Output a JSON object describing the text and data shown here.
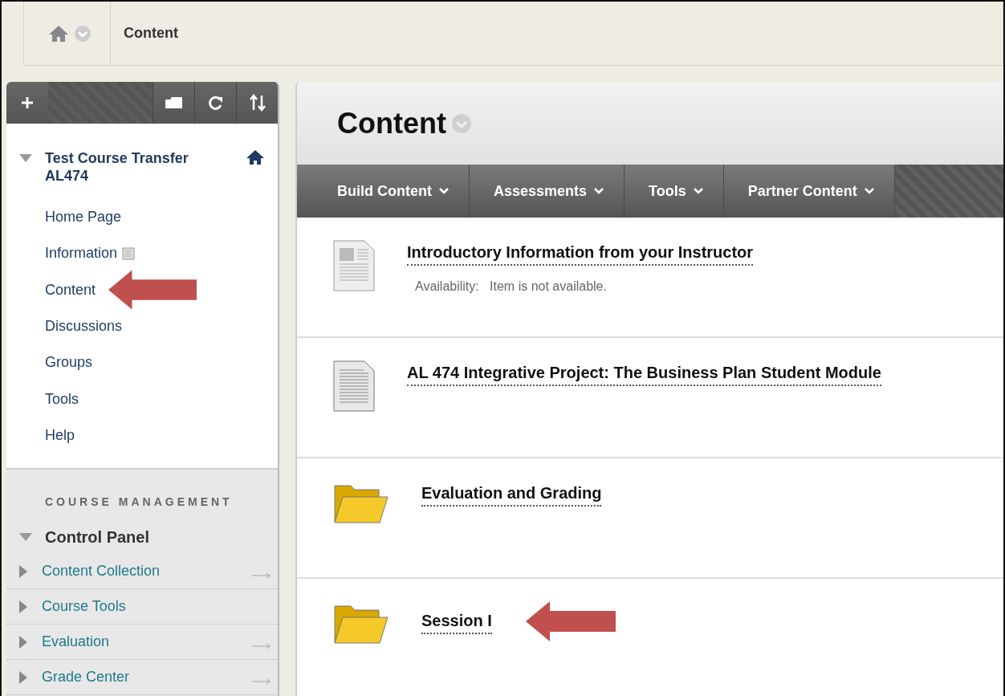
{
  "breadcrumb": {
    "current": "Content"
  },
  "sidebar": {
    "course_title": "Test Course Transfer AL474",
    "items": [
      {
        "label": "Home Page",
        "has_icon": false,
        "pointed": false
      },
      {
        "label": "Information",
        "has_icon": true,
        "pointed": false
      },
      {
        "label": "Content",
        "has_icon": false,
        "pointed": true
      },
      {
        "label": "Discussions",
        "has_icon": false,
        "pointed": false
      },
      {
        "label": "Groups",
        "has_icon": false,
        "pointed": false
      },
      {
        "label": "Tools",
        "has_icon": false,
        "pointed": false
      },
      {
        "label": "Help",
        "has_icon": false,
        "pointed": false
      }
    ],
    "management_heading": "COURSE MANAGEMENT",
    "control_panel": {
      "label": "Control Panel",
      "expanded": true,
      "items": [
        {
          "label": "Content Collection",
          "external": true
        },
        {
          "label": "Course Tools",
          "external": false
        },
        {
          "label": "Evaluation",
          "external": true
        },
        {
          "label": "Grade Center",
          "external": true
        }
      ]
    }
  },
  "page": {
    "title": "Content",
    "menus": [
      "Build Content",
      "Assessments",
      "Tools",
      "Partner Content"
    ],
    "items": [
      {
        "kind": "document-image",
        "title": "Introductory Information from your Instructor",
        "availability_label": "Availability:",
        "availability": "Item is not available.",
        "pointed": false
      },
      {
        "kind": "document",
        "title": "AL 474 Integrative Project: The Business Plan Student Module",
        "pointed": false
      },
      {
        "kind": "folder",
        "title": "Evaluation and Grading",
        "pointed": false
      },
      {
        "kind": "folder",
        "title": "Session I",
        "pointed": true
      }
    ]
  }
}
